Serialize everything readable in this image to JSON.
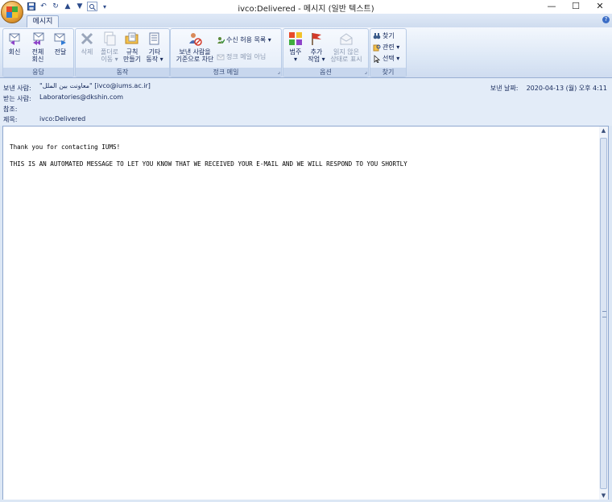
{
  "window": {
    "title": "ivco:Delivered - 메시지 (일반 텍스트)",
    "controls": {
      "minimize": "—",
      "maximize": "☐",
      "close": "✕"
    }
  },
  "tabs": [
    {
      "label": "메시지",
      "selected": true
    }
  ],
  "ribbon": {
    "groups": {
      "respond": {
        "label": "응답",
        "buttons": [
          {
            "label_line1": "회신",
            "label_line2": "",
            "icon": "reply-icon"
          },
          {
            "label_line1": "전체",
            "label_line2": "회신",
            "icon": "reply-all-icon"
          },
          {
            "label_line1": "전달",
            "label_line2": "",
            "icon": "forward-icon"
          }
        ]
      },
      "actions": {
        "label": "동작",
        "buttons": [
          {
            "label_line1": "삭제",
            "label_line2": "",
            "icon": "delete-icon",
            "disabled": true
          },
          {
            "label_line1": "폴더로",
            "label_line2": "이동 ▾",
            "icon": "move-to-folder-icon",
            "disabled": true
          },
          {
            "label_line1": "규칙",
            "label_line2": "만들기",
            "icon": "create-rule-icon"
          },
          {
            "label_line1": "기타",
            "label_line2": "동작 ▾",
            "icon": "other-actions-icon"
          }
        ]
      },
      "junk": {
        "label": "정크 메일",
        "block_sender_line1": "보낸 사람을",
        "block_sender_line2": "기준으로 차단",
        "safe_list": "수신 허용 목록 ▾",
        "not_junk": "정크 메일 아님"
      },
      "options": {
        "label": "옵션",
        "buttons": [
          {
            "label_line1": "범주",
            "label_line2": "▾",
            "icon": "categorize-icon"
          },
          {
            "label_line1": "추가",
            "label_line2": "작업 ▾",
            "icon": "follow-up-flag-icon"
          },
          {
            "label_line1": "읽지 않은",
            "label_line2": "상태로 표시",
            "icon": "mark-unread-icon",
            "disabled": true
          }
        ]
      },
      "find": {
        "label": "찾기",
        "items": [
          {
            "label": "찾기",
            "icon": "binoculars-icon"
          },
          {
            "label": "관련 ▾",
            "icon": "related-icon"
          },
          {
            "label": "선택 ▾",
            "icon": "select-icon"
          }
        ]
      }
    }
  },
  "header": {
    "from_label": "보낸 사람:",
    "from_value": "\"معاونت بین الملل\" [ivco@iums.ac.ir]",
    "to_label": "받는 사람:",
    "to_value": "Laboratories@dkshin.com",
    "cc_label": "참조:",
    "cc_value": "",
    "subject_label": "제목:",
    "subject_value": "ivco:Delivered",
    "sent_label": "보낸 날짜:",
    "sent_value": "2020-04-13 (월) 오후 4:11"
  },
  "body": {
    "line1": "Thank you for contacting IUMS!",
    "line2": "THIS IS AN AUTOMATED MESSAGE TO LET YOU KNOW THAT WE RECEIVED YOUR E-MAIL AND WE WILL RESPOND TO YOU SHORTLY"
  },
  "colors": {
    "accent": "#3b6dc6",
    "ribbon_bg": "#dde8f6",
    "disabled_text": "#8a98b0"
  }
}
